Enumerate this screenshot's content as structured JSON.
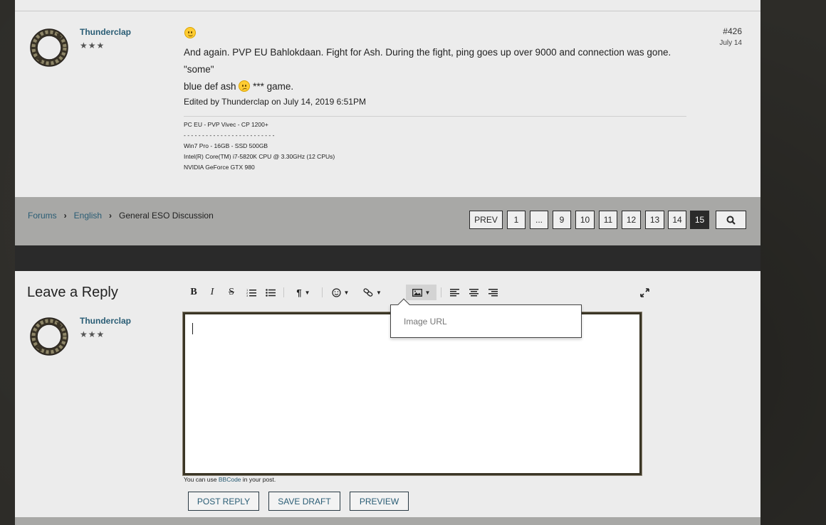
{
  "post": {
    "username": "Thunderclap",
    "rank": "★★★",
    "post_number": "#426",
    "date": "July 14",
    "body_line1": "And again. PVP EU Bahlokdaan. Fight for Ash. During the fight, ping goes up over 9000 and connection was gone. \"some\"",
    "body_line2_a": "blue def ash",
    "body_line2_b": "*** game.",
    "edited": "Edited by Thunderclap on July 14, 2019 6:51PM",
    "signature": [
      "PC EU - PVP Vivec - CP 1200+",
      "- - - - - - - - - - - - - - - - - - - - - - - - -",
      "Win7 Pro - 16GB - SSD 500GB",
      "Intel(R) Core(TM) i7-5820K CPU @ 3.30GHz (12 CPUs)",
      "NVIDIA GeForce GTX 980"
    ]
  },
  "breadcrumb": {
    "items": [
      "Forums",
      "English",
      "General ESO Discussion"
    ]
  },
  "pagination": {
    "prev": "PREV",
    "pages": [
      "1",
      "...",
      "9",
      "10",
      "11",
      "12",
      "13",
      "14",
      "15"
    ],
    "current": "15"
  },
  "reply": {
    "title": "Leave a Reply",
    "username": "Thunderclap",
    "rank": "★★★",
    "image_url_placeholder": "Image URL",
    "bbcode_prefix": "You can use",
    "bbcode_link": "BBCode",
    "bbcode_suffix": "in your post.",
    "buttons": {
      "post": "POST REPLY",
      "save": "SAVE DRAFT",
      "preview": "PREVIEW"
    }
  },
  "toolbar": {
    "bold": "B",
    "italic": "I",
    "strike": "S",
    "paragraph": "¶"
  }
}
